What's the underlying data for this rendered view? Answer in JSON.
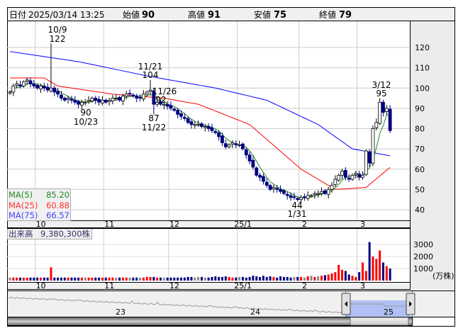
{
  "header": {
    "date_label": "日付",
    "datetime": "2025/03/14 13:25",
    "open_label": "始値",
    "open": "90",
    "high_label": "高値",
    "high": "91",
    "low_label": "安値",
    "low": "75",
    "close_label": "終値",
    "close": "79"
  },
  "colors": {
    "up_fill": "#ffffff",
    "down_fill": "#000080",
    "ma5": "#228B22",
    "ma25": "#ff0000",
    "ma75": "#0000ff",
    "vol_up": "#ff0000",
    "vol_down": "#000080",
    "vol_flat": "#888888",
    "high_text": "#ff0000",
    "low_text": "#008000"
  },
  "legend": {
    "ma5_label": "MA(5)",
    "ma5_value": "85.20",
    "ma25_label": "MA(25)",
    "ma25_value": "60.88",
    "ma75_label": "MA(75)",
    "ma75_value": "66.57"
  },
  "volume_label": {
    "label": "出来高",
    "value": "9,380,300株"
  },
  "annotations": [
    {
      "date": "10/9",
      "price": "122"
    },
    {
      "date": "11/21",
      "price": "104"
    },
    {
      "date": "11/26",
      "price": "92"
    },
    {
      "date": "11/22",
      "price": "87"
    },
    {
      "date": "10/23",
      "price": "90"
    },
    {
      "date": "3/12",
      "price": "95"
    },
    {
      "date": "1/31",
      "price": "44"
    }
  ],
  "navigator": {
    "year_labels": [
      "23",
      "24",
      "25"
    ]
  },
  "chart_data": {
    "type": "candlestick",
    "y_ticks": [
      "120",
      "110",
      "100",
      "90",
      "80",
      "70",
      "60",
      "50",
      "40"
    ],
    "ylim": [
      40,
      120
    ],
    "x_tick_labels": [
      "10",
      "11",
      "12",
      "25/1",
      "2",
      "3"
    ],
    "x_tick_index": [
      8,
      28,
      47,
      67,
      85,
      102
    ],
    "volume_ticks": [
      "3000",
      "2000",
      "1000"
    ],
    "volume_unit": "(万株)",
    "closes": [
      98,
      101,
      102,
      101,
      103,
      104,
      102,
      101,
      100,
      101,
      100,
      99,
      100,
      98,
      97,
      95,
      94,
      95,
      94,
      93,
      92,
      93,
      93,
      94,
      95,
      94,
      93,
      94,
      93,
      94,
      95,
      95,
      94,
      96,
      97,
      97,
      96,
      95,
      95,
      97,
      98,
      99,
      92,
      93,
      92,
      92,
      91,
      90,
      89,
      87,
      86,
      85,
      83,
      82,
      82,
      82,
      81,
      81,
      80,
      79,
      78,
      76,
      73,
      71,
      72,
      73,
      72,
      72,
      70,
      67,
      64,
      61,
      57,
      56,
      54,
      52,
      50,
      51,
      50,
      49,
      48,
      47,
      46,
      46,
      45,
      46,
      46,
      47,
      47,
      48,
      48,
      49,
      48,
      50,
      52,
      55,
      57,
      59,
      56,
      55,
      57,
      58,
      56,
      57,
      69,
      63,
      80,
      83,
      93,
      88,
      90,
      79
    ],
    "special_highs": [
      {
        "index": 12,
        "value": 122
      },
      {
        "index": 41,
        "value": 104
      },
      {
        "index": 108,
        "value": 95
      }
    ],
    "special_lows": [
      {
        "index": 20,
        "value": 90
      },
      {
        "index": 42,
        "value": 87
      },
      {
        "index": 84,
        "value": 44
      }
    ],
    "ma25_points": [
      [
        0,
        105
      ],
      [
        10,
        105
      ],
      [
        14,
        101
      ],
      [
        30,
        97
      ],
      [
        45,
        95
      ],
      [
        55,
        92
      ],
      [
        70,
        82
      ],
      [
        85,
        60
      ],
      [
        95,
        50
      ],
      [
        104,
        51
      ],
      [
        111,
        60.88
      ]
    ],
    "ma75_points": [
      [
        0,
        118
      ],
      [
        20,
        113
      ],
      [
        40,
        106
      ],
      [
        60,
        100
      ],
      [
        75,
        94
      ],
      [
        90,
        82
      ],
      [
        100,
        70
      ],
      [
        111,
        66.57
      ]
    ],
    "volume": [
      250,
      250,
      250,
      250,
      250,
      250,
      250,
      250,
      250,
      250,
      250,
      250,
      1100,
      250,
      250,
      250,
      250,
      250,
      250,
      250,
      250,
      250,
      250,
      250,
      250,
      250,
      250,
      250,
      250,
      250,
      250,
      250,
      250,
      250,
      250,
      250,
      250,
      250,
      250,
      250,
      300,
      300,
      300,
      250,
      250,
      250,
      250,
      250,
      250,
      250,
      250,
      250,
      300,
      300,
      250,
      300,
      300,
      250,
      250,
      300,
      350,
      300,
      300,
      350,
      300,
      250,
      250,
      300,
      300,
      250,
      300,
      400,
      350,
      300,
      400,
      300,
      350,
      300,
      250,
      350,
      300,
      300,
      250,
      300,
      300,
      300,
      250,
      350,
      400,
      300,
      350,
      400,
      450,
      500,
      600,
      700,
      1300,
      900,
      800,
      500,
      400,
      300,
      700,
      1500,
      800,
      3200,
      2000,
      1800,
      2500,
      1500,
      1200,
      1000
    ]
  }
}
